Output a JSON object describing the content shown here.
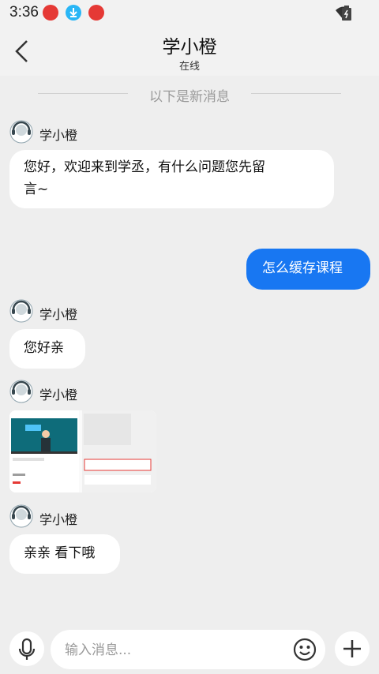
{
  "status_bar": {
    "time": "3:36"
  },
  "header": {
    "title": "学小橙",
    "subtitle": "在线"
  },
  "divider": {
    "label": "以下是新消息"
  },
  "messages": [
    {
      "sender": "学小橙",
      "text": "您好，欢迎来到学丞，有什么问题您先留",
      "text2": "言~"
    },
    {
      "sender": "me",
      "text": "怎么缓存课程"
    },
    {
      "sender": "学小橙",
      "text": "您好亲"
    },
    {
      "sender": "学小橙",
      "type": "image"
    },
    {
      "sender": "学小橙",
      "text": "亲亲 看下哦"
    }
  ],
  "composer": {
    "placeholder": "输入消息..."
  },
  "colors": {
    "accent": "#1877f2",
    "background": "#eeeeee",
    "bubble": "#ffffff"
  }
}
